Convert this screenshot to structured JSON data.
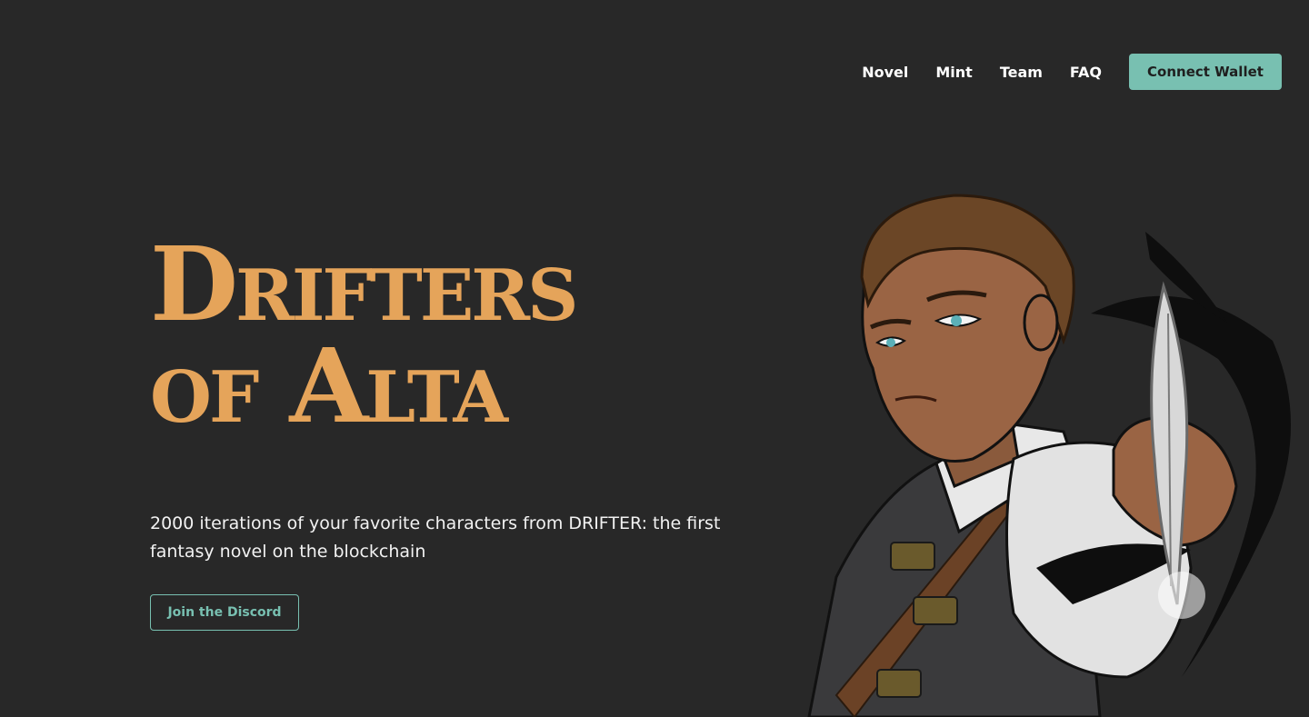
{
  "nav": {
    "items": [
      {
        "label": "Novel"
      },
      {
        "label": "Mint"
      },
      {
        "label": "Team"
      },
      {
        "label": "FAQ"
      }
    ],
    "connect_label": "Connect Wallet"
  },
  "hero": {
    "title_line1": "Drifters",
    "title_line2": "of Alta",
    "tagline": "2000 iterations of your favorite characters from DRIFTER: the first fantasy novel on the blockchain",
    "discord_label": "Join the Discord"
  },
  "colors": {
    "background": "#282828",
    "title": "#e5a45a",
    "accent": "#78c0b1",
    "text": "#ffffff"
  }
}
